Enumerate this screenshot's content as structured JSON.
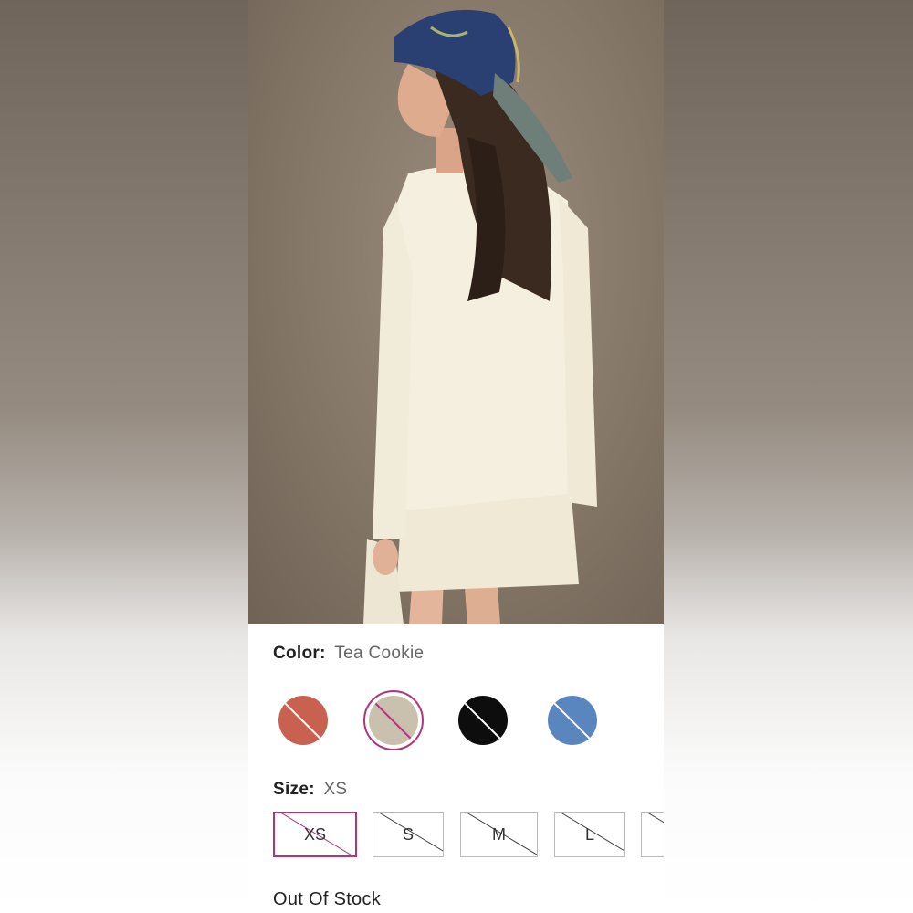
{
  "color": {
    "label": "Color:",
    "value": "Tea Cookie",
    "swatches": [
      {
        "name": "terracotta",
        "hex": "#c8614f",
        "selected": false,
        "unavailable": true
      },
      {
        "name": "tea-cookie",
        "hex": "#c9c0ae",
        "selected": true,
        "unavailable": true
      },
      {
        "name": "black",
        "hex": "#0d0d0d",
        "selected": false,
        "unavailable": true
      },
      {
        "name": "blue",
        "hex": "#5a86c0",
        "selected": false,
        "unavailable": true
      }
    ]
  },
  "size": {
    "label": "Size:",
    "value": "XS",
    "options": [
      "XS",
      "S",
      "M",
      "L",
      ""
    ],
    "selected": "XS"
  },
  "stock_status": "Out Of Stock",
  "accent_color": "#b0357a"
}
